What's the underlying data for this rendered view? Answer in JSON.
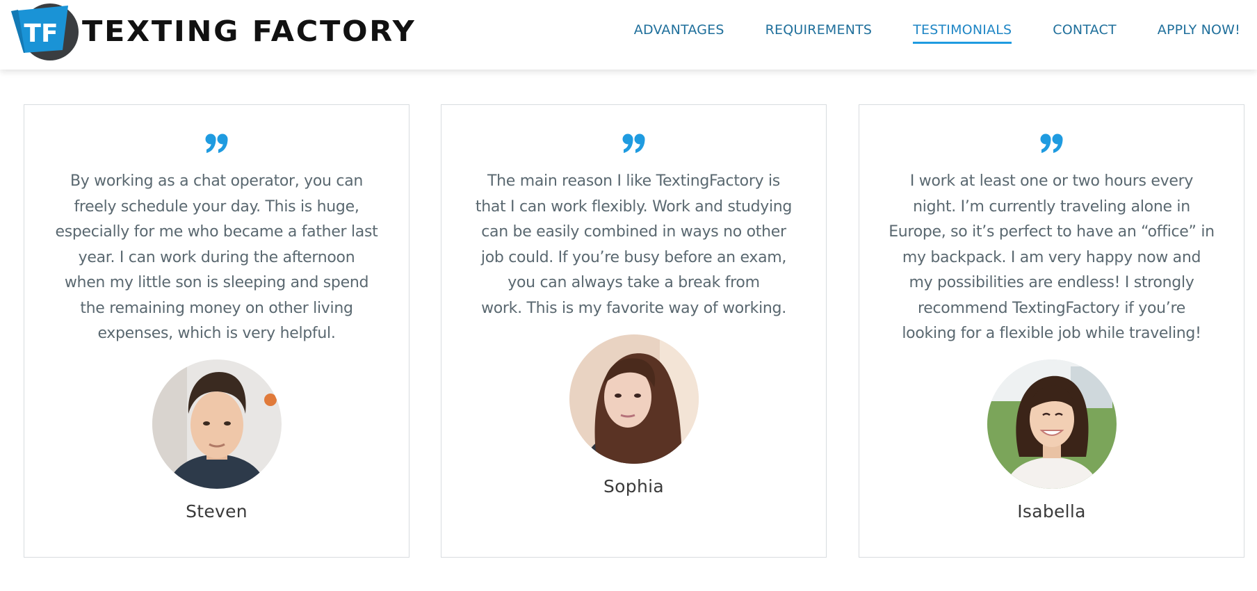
{
  "brand": {
    "logo_initials": "TF",
    "logo_text": "TEXTING FACTORY",
    "accent_color": "#1f9be0"
  },
  "nav": {
    "items": [
      {
        "label": "ADVANTAGES"
      },
      {
        "label": "REQUIREMENTS"
      },
      {
        "label": "TESTIMONIALS",
        "active": true
      },
      {
        "label": "CONTACT"
      },
      {
        "label": "APPLY NOW!"
      }
    ]
  },
  "testimonials": [
    {
      "icon": "quote-icon",
      "lines": [
        "By working as a chat operator, you can",
        "freely schedule your day. This is huge,",
        "especially for me who became a father last",
        "year. I can work during the afternoon",
        "when my little son is sleeping and spend",
        "the remaining money on other living",
        "expenses, which is very helpful."
      ],
      "name": "Steven"
    },
    {
      "icon": "quote-icon",
      "lines": [
        "The main reason I like TextingFactory is",
        "that I can work flexibly. Work and studying",
        "can be easily combined in ways no other",
        "job could. If you’re busy before an exam,",
        "you can always take a break from",
        "work. This is my favorite way of working."
      ],
      "name": "Sophia"
    },
    {
      "icon": "quote-icon",
      "lines": [
        "I work at least one or two hours every",
        "night. I’m currently traveling alone in",
        "Europe, so it’s perfect to have an “office” in",
        "my backpack. I am very happy now and",
        "my possibilities are endless! I strongly",
        "recommend TextingFactory if you’re",
        "looking for a flexible job while traveling!"
      ],
      "name": "Isabella"
    }
  ]
}
